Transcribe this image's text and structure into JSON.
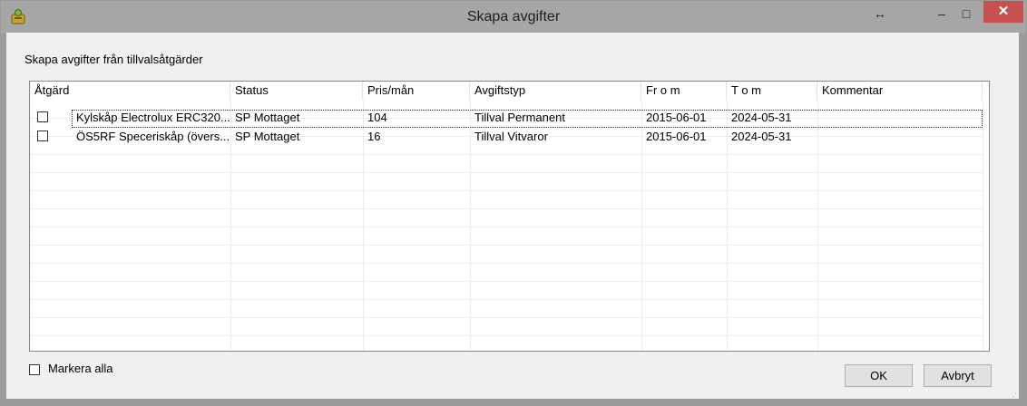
{
  "window": {
    "title": "Skapa avgifter",
    "icon": "app-money-icon",
    "controls": {
      "resize": "↔",
      "minimize": "–",
      "maximize": "□",
      "close": "✕"
    }
  },
  "subtitle": "Skapa avgifter från tillvalsåtgärder",
  "grid": {
    "columns": [
      "Åtgärd",
      "Status",
      "Pris/mån",
      "Avgiftstyp",
      "Fr o m",
      "T o m",
      "Kommentar"
    ],
    "rows": [
      {
        "checked": false,
        "atgard": "Kylskåp Electrolux ERC320...",
        "status": "SP Mottaget",
        "pris": "104",
        "avgiftstyp": "Tillval Permanent",
        "from": "2015-06-01",
        "tom": "2024-05-31",
        "kommentar": ""
      },
      {
        "checked": false,
        "atgard": "ÖS5RF Speceriskåp (övers...",
        "status": "SP Mottaget",
        "pris": "16",
        "avgiftstyp": "Tillval Vitvaror",
        "from": "2015-06-01",
        "tom": "2024-05-31",
        "kommentar": ""
      }
    ]
  },
  "footer": {
    "select_all_label": "Markera alla",
    "ok_label": "OK",
    "cancel_label": "Avbryt"
  },
  "colors": {
    "titlebar": "#a6a6a6",
    "close_button": "#c75050",
    "client_bg": "#f0f0f0"
  }
}
